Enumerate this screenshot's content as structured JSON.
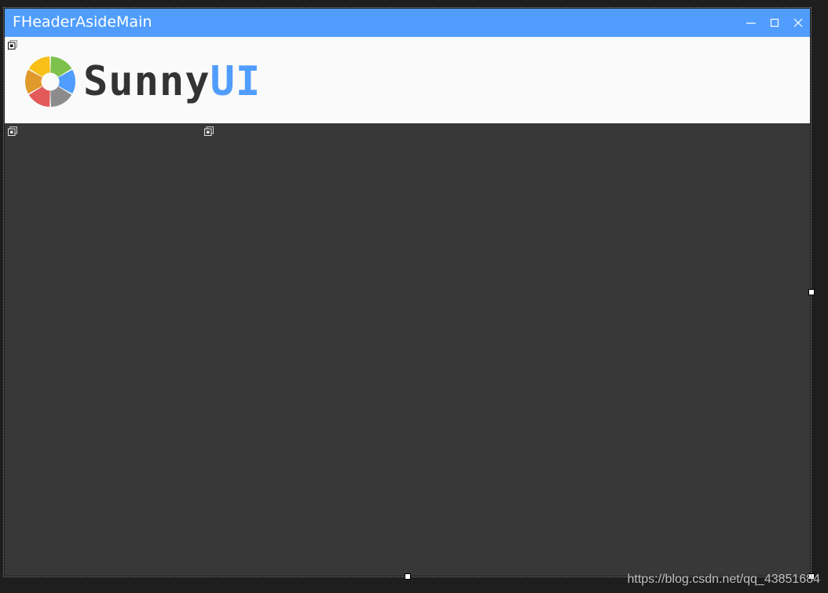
{
  "window": {
    "title": "FHeaderAsideMain",
    "controls": {
      "minimize": "minimize-icon",
      "maximize": "maximize-icon",
      "close": "close-icon"
    }
  },
  "header": {
    "logo_icon": "sunnyui-logo-icon",
    "brand_text_part1": "Sunny",
    "brand_text_part2": "UI",
    "logo_colors": [
      "#7cc14b",
      "#509dfd",
      "#8c8c8c",
      "#e45a5a",
      "#e09a2c",
      "#f8c018"
    ]
  },
  "colors": {
    "title_bar": "#509dfd",
    "header_background": "#fafafa",
    "body_background": "#383838",
    "brand_dark": "#333333",
    "brand_accent": "#509dfd"
  },
  "watermark": "https://blog.csdn.net/qq_43851684"
}
